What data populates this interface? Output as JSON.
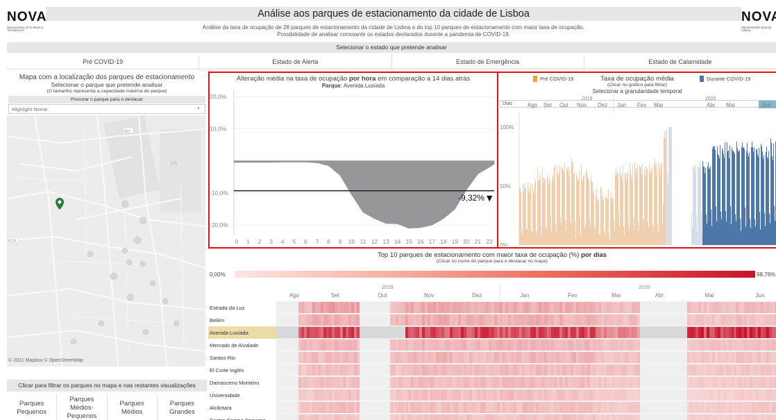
{
  "header": {
    "logo_left": {
      "mark": "NOVA",
      "sub": "NOVA SCHOOL OF SCIENCE & TECHNOLOGY"
    },
    "logo_right": {
      "mark": "NOVA",
      "sub": "UNIVERSIDADE NOVA DE LISBOA"
    },
    "title": "Análise aos parques de estacionamento da cidade de Lisboa",
    "subtitle_line1": "Análise da taxa de ocupação de 28 parques de estacionamento da cidade de Lisboa e do top 10 parques de estacionamento com maior taxa de ocupação.",
    "subtitle_line2": "Possibilidade de analisar consoante os estados declarados durante a pandemia de COVID-19."
  },
  "state_selector": {
    "label": "Selecionar o estado que pretende analisar",
    "tabs": [
      "Pré COVID-19",
      "Estado de Alerta",
      "Estado de Emergência",
      "Estado de Calamidade"
    ]
  },
  "map_panel": {
    "title": "Mapa com a localização dos parques de estacionamento",
    "subtitle": "Selecionar o parque que pretende analisar",
    "note": "(O tamanho representa a capacidade máxima do parque)",
    "search_label": "Procurar o parque para o destacar",
    "search_placeholder": "Highlight Nome",
    "attribution": "© 2021 Mapbox © OpenStreetMap",
    "map_labels": [
      "IP7",
      "LIS",
      "IC19"
    ],
    "filter_label": "Clicar para filtrar os parques no mapa e nas restantes visualizações",
    "size_filters": [
      "Parques Pequenos",
      "Parques Médios-Pequenos",
      "Parques Médios",
      "Parques Grandes"
    ]
  },
  "hourly_chart": {
    "title_pre": "Alteração média na taxa de ocupação ",
    "title_bold": "por hora",
    "title_post": " em comparação a 14 dias atrás",
    "park_label": "Parque",
    "park_name": "Avenida Lusíada",
    "reference_label": "-9,32%",
    "reference_marker": "▼"
  },
  "occupancy_chart": {
    "title": "Taxa de ocupação média",
    "note": "(Clicar no gráfico para filtrar)",
    "instruction": "Selecionar a granularidade temporal",
    "legend_pre": "Pré COVID-19",
    "legend_during": "Durante COVID-19",
    "granularity": "Dias",
    "granularity_arrow": "▾"
  },
  "top10": {
    "title_pre": "Top 10 parques de estacionamento com maior taxa de ocupação (%) ",
    "title_bold": "por dias",
    "note": "(Clicar no nome do parque para o destacar no mapa)",
    "color_min": "0,00%",
    "color_max": "98,76%",
    "parks": [
      "Estrada da Luz",
      "Belém",
      "Avenida Lusíada",
      "Mercado de Alvalade",
      "Santos-Rio",
      "El Corte Inglés",
      "Damasceno Monteiro",
      "Universidade",
      "Alcântara",
      "Centro Campo Pequeno"
    ],
    "highlighted_index": 2
  },
  "chart_data": [
    {
      "type": "area",
      "title": "Alteração média na taxa de ocupação por hora em comparação a 14 dias atrás",
      "x": [
        0,
        1,
        2,
        3,
        4,
        5,
        6,
        7,
        8,
        9,
        10,
        11,
        12,
        13,
        14,
        15,
        16,
        17,
        18,
        19,
        20,
        21,
        22
      ],
      "tick_labels": [
        "0",
        "1",
        "2",
        "3",
        "4",
        "5",
        "6",
        "7",
        "8",
        "9",
        "10",
        "11",
        "12",
        "13",
        "14",
        "15",
        "16",
        "17",
        "18",
        "19",
        "20",
        "21",
        "22"
      ],
      "values": [
        -0.5,
        -0.5,
        -0.5,
        -0.5,
        -0.4,
        -0.4,
        -0.4,
        -0.6,
        -1.5,
        -4.5,
        -10.5,
        -16.0,
        -18.0,
        -19.5,
        -19.6,
        -21.0,
        -20.8,
        -20.0,
        -18.0,
        -15.0,
        -9.0,
        -4.0,
        -2.0
      ],
      "extra_end_value": -1.0,
      "reference_line": -9.32,
      "ylim": [
        -23,
        22
      ],
      "y_ticks": [
        20,
        10,
        -10,
        -20
      ],
      "y_tick_labels": [
        "20,0%",
        "10,0%",
        "-10,0%",
        "-20,0%"
      ],
      "colors": {
        "area": "#95979b",
        "reference": "#222222"
      }
    },
    {
      "type": "bar",
      "title": "Taxa de ocupação média",
      "y_ticks": [
        100,
        50,
        0
      ],
      "y_tick_labels": [
        "100%",
        "50%",
        "0%"
      ],
      "ylim": [
        0,
        100
      ],
      "years": [
        "2019",
        "2020"
      ],
      "months": [
        "Ago",
        "Set",
        "Out",
        "Nov",
        "Dez",
        "Jan",
        "Fev",
        "Mar",
        "Abr",
        "Mai",
        "Jun"
      ],
      "highlighted_month": "Jun",
      "weekly_profile": [
        62,
        60,
        58,
        57,
        60,
        20,
        12
      ],
      "month_levels": [
        50,
        58,
        66,
        60,
        44,
        63,
        63,
        68,
        0,
        70,
        82
      ],
      "series": [
        {
          "name": "Pré COVID-19",
          "color": "#f0cfae"
        },
        {
          "name": "Durante COVID-19",
          "color": "#4d77a8"
        }
      ]
    },
    {
      "type": "heatmap",
      "title": "Top 10 parques de estacionamento com maior taxa de ocupação (%) por dias",
      "color_range": [
        0.0,
        98.76
      ],
      "years": [
        "2019",
        "2020"
      ],
      "months": [
        "Ago",
        "Set",
        "Out",
        "Nov",
        "Dez",
        "Jan",
        "Fev",
        "Mar",
        "Abr",
        "Mai",
        "Jun"
      ],
      "rows": [
        "Estrada da Luz",
        "Belém",
        "Avenida Lusíada",
        "Mercado de Alvalade",
        "Santos-Rio",
        "El Corte Inglés",
        "Damasceno Monteiro",
        "Universidade",
        "Alcântara",
        "Centro Campo Pequeno"
      ],
      "row_month_levels": [
        [
          20,
          30,
          18,
          26,
          24,
          26,
          24,
          18,
          0,
          16,
          18
        ],
        [
          18,
          25,
          18,
          24,
          22,
          24,
          22,
          16,
          0,
          14,
          16
        ],
        [
          70,
          72,
          0,
          70,
          72,
          70,
          72,
          40,
          0,
          78,
          86
        ],
        [
          18,
          20,
          16,
          20,
          20,
          20,
          20,
          15,
          0,
          14,
          16
        ],
        [
          16,
          18,
          16,
          20,
          18,
          20,
          20,
          14,
          0,
          12,
          14
        ],
        [
          14,
          16,
          14,
          18,
          16,
          18,
          18,
          14,
          0,
          12,
          14
        ],
        [
          14,
          16,
          14,
          18,
          16,
          18,
          16,
          12,
          0,
          10,
          12
        ],
        [
          10,
          14,
          12,
          16,
          14,
          16,
          14,
          10,
          0,
          8,
          10
        ],
        [
          14,
          16,
          14,
          16,
          16,
          16,
          16,
          12,
          0,
          10,
          12
        ],
        [
          12,
          14,
          12,
          14,
          14,
          14,
          14,
          10,
          0,
          8,
          10
        ]
      ]
    }
  ],
  "colors": {
    "highlight_bg": "#ebdca8",
    "frame": "#dd1111",
    "panel_bg": "#e6e6e6"
  }
}
